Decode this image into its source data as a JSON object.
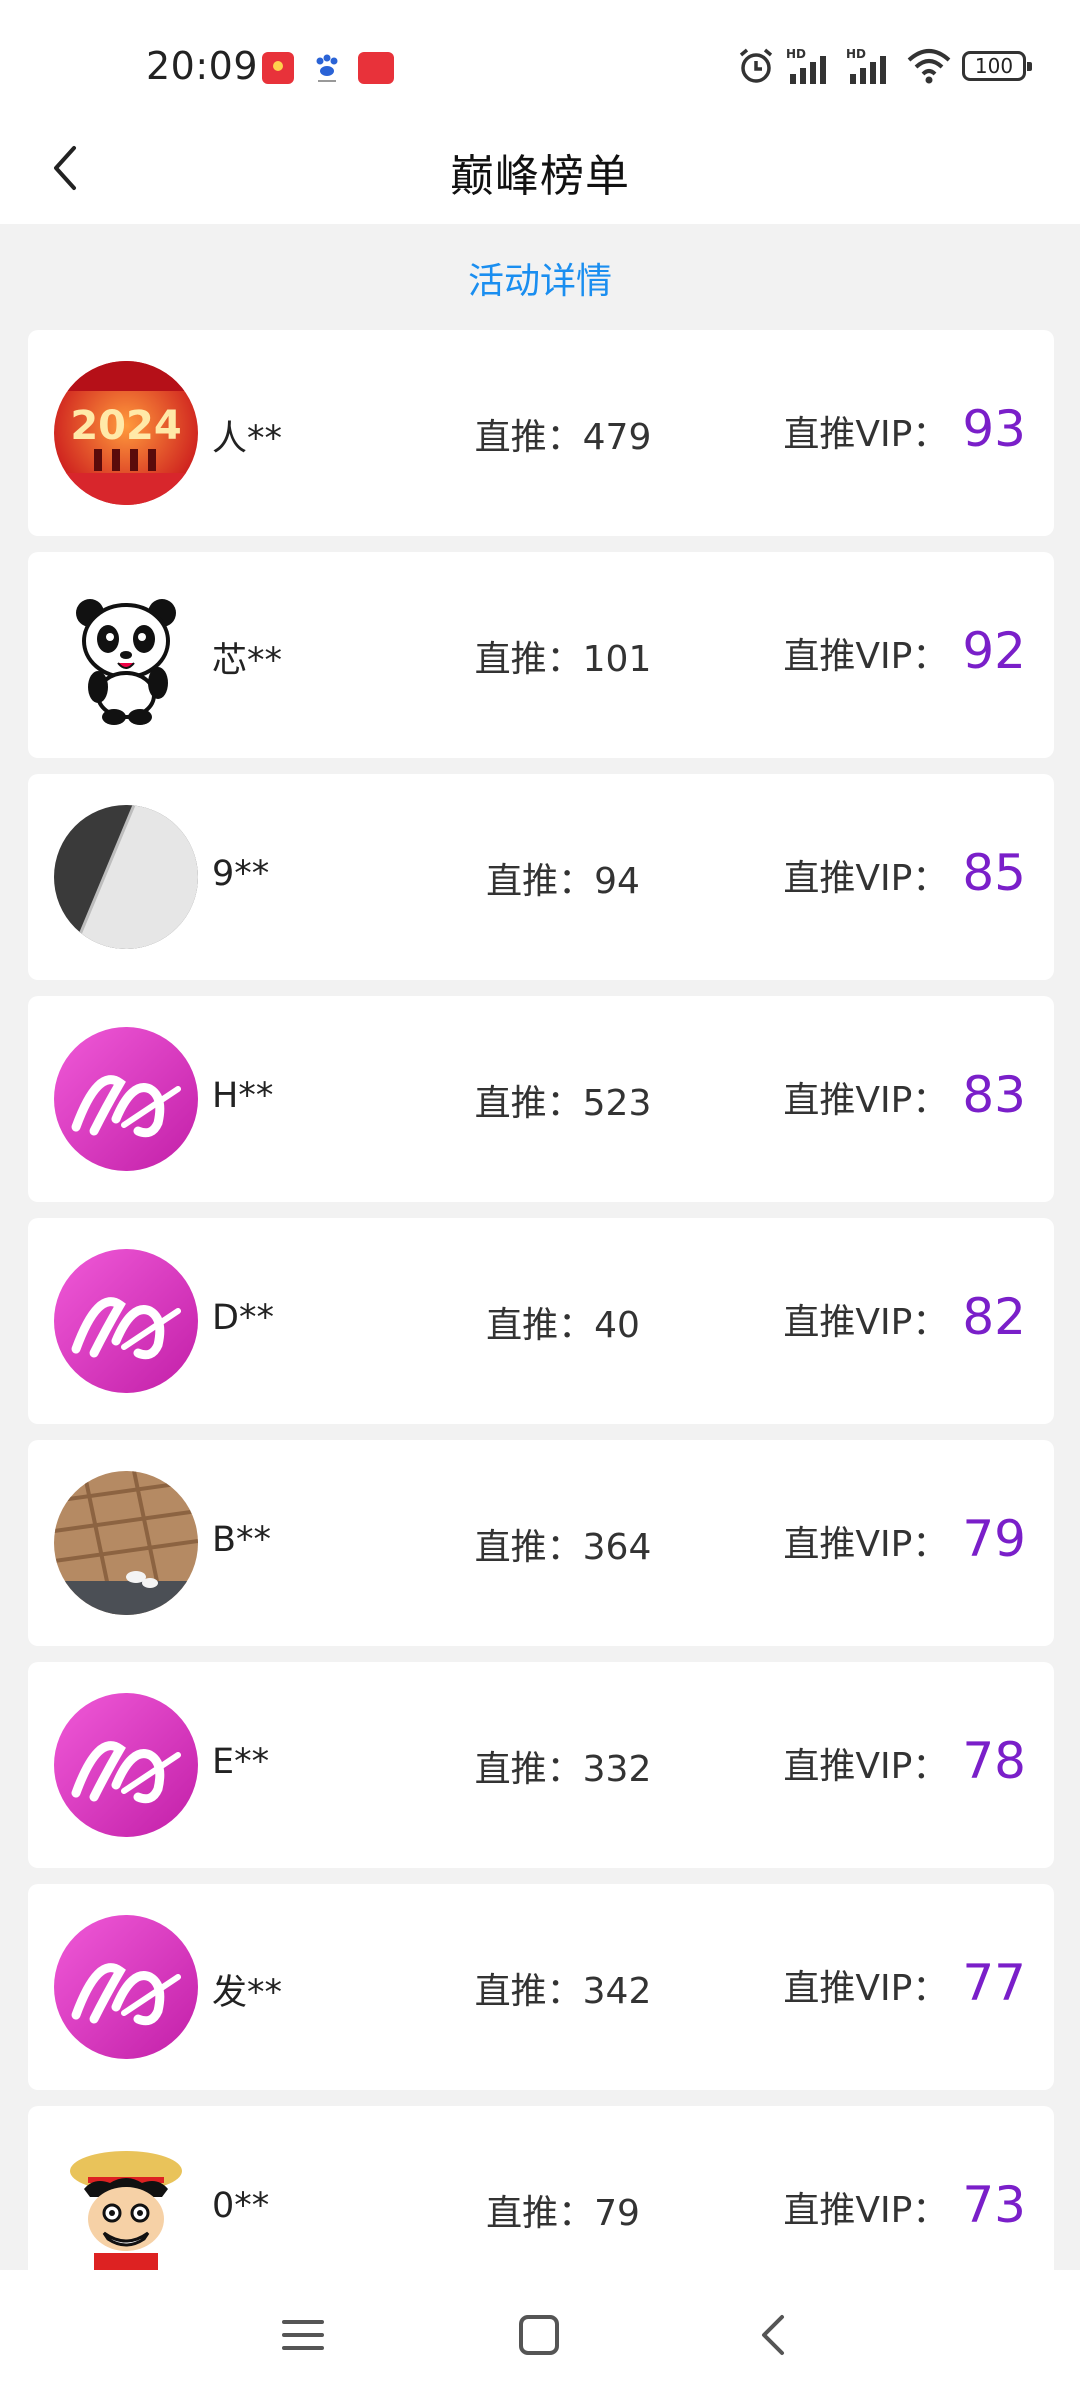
{
  "status_bar": {
    "time": "20:09",
    "battery": "100",
    "icons": [
      "alarm-icon",
      "hd-signal-icon",
      "hd-signal-icon",
      "wifi-icon",
      "battery-icon"
    ]
  },
  "header": {
    "title": "巅峰榜单"
  },
  "activity_link": "活动详情",
  "ranking": [
    {
      "name": "人**",
      "direct": "直推：479",
      "vip_label": "直推VIP：",
      "vip": "93",
      "avatar": "avatar-2024"
    },
    {
      "name": "芯**",
      "direct": "直推：101",
      "vip_label": "直推VIP：",
      "vip": "92",
      "avatar": "avatar-panda"
    },
    {
      "name": "9**",
      "direct": "直推：94",
      "vip_label": "直推VIP：",
      "vip": "85",
      "avatar": "avatar-gray"
    },
    {
      "name": "H**",
      "direct": "直推：523",
      "vip_label": "直推VIP：",
      "vip": "83",
      "avatar": "avatar-brand"
    },
    {
      "name": "D**",
      "direct": "直推：40",
      "vip_label": "直推VIP：",
      "vip": "82",
      "avatar": "avatar-brand"
    },
    {
      "name": "B**",
      "direct": "直推：364",
      "vip_label": "直推VIP：",
      "vip": "79",
      "avatar": "avatar-photo"
    },
    {
      "name": "E**",
      "direct": "直推：332",
      "vip_label": "直推VIP：",
      "vip": "78",
      "avatar": "avatar-brand"
    },
    {
      "name": "发**",
      "direct": "直推：342",
      "vip_label": "直推VIP：",
      "vip": "77",
      "avatar": "avatar-brand"
    },
    {
      "name": "0**",
      "direct": "直推：79",
      "vip_label": "直推VIP：",
      "vip": "73",
      "avatar": "avatar-cartoon"
    }
  ],
  "colors": {
    "accent_link": "#1a8ef0",
    "vip_value": "#7a1fc9",
    "brand_pink": "#e23fc4",
    "background": "#f2f2f2"
  },
  "nav": {
    "icons": [
      "menu-icon",
      "home-icon",
      "back-icon"
    ]
  }
}
